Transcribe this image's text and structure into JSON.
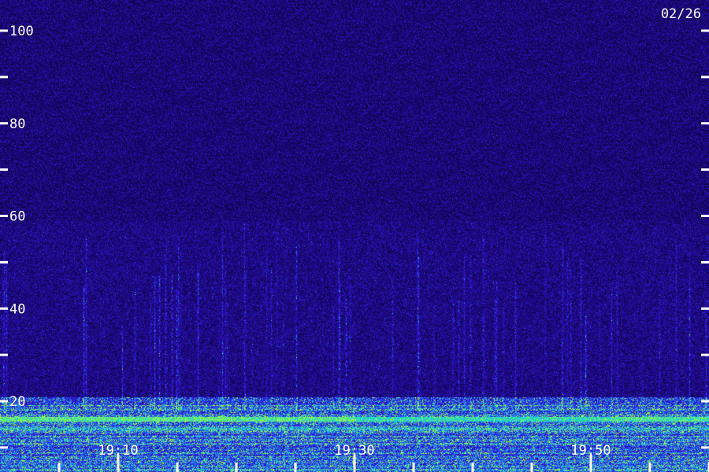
{
  "date_label": "02/26",
  "chart_data": {
    "type": "heatmap",
    "title": "",
    "xlabel": "",
    "ylabel": "",
    "y_range": [
      12,
      103
    ],
    "y_ticks_labeled": [
      20,
      40,
      60,
      80,
      100
    ],
    "y_ticks_unlabeled": [
      10,
      30,
      50,
      70,
      90
    ],
    "x_range_minutes": [
      "19:04",
      "20:04"
    ],
    "x_ticks_labeled": [
      "19:10",
      "19:30",
      "19:50"
    ],
    "x_ticks_unlabeled": [
      "19:05",
      "19:15",
      "19:20",
      "19:25",
      "19:35",
      "19:40",
      "19:45",
      "19:55",
      "20:00"
    ],
    "colors": {
      "background": "#1a0f6e",
      "noise_dark": "#0a0440",
      "noise_mid": "#3a1fb0",
      "signal_blue": "#2a7aff",
      "signal_cyan": "#22d8e0",
      "signal_green": "#9cff3a",
      "tick_white": "#ffffff"
    },
    "features": [
      {
        "name": "",
        "y_band": [
          12,
          17
        ],
        "intensity": "high"
      },
      {
        "name": "",
        "y_band": [
          17,
          19
        ],
        "intensity": "medium"
      },
      {
        "name": "",
        "y_band": [
          20,
          58
        ],
        "intensity": "low-vertical-streaks"
      }
    ]
  }
}
